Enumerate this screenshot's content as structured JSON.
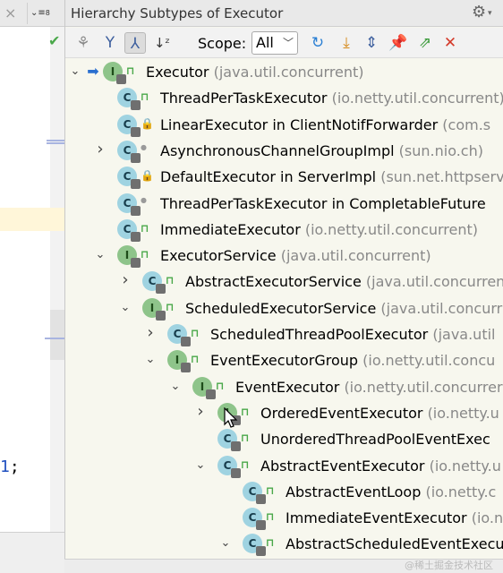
{
  "editor": {
    "tabs_menu": "⌄≡",
    "code_text": "1;",
    "code_number": "1"
  },
  "panel": {
    "title": "Hierarchy Subtypes of Executor",
    "toolbar": {
      "scope_label": "Scope:",
      "scope_value": "All"
    }
  },
  "tree": [
    {
      "label": "Executor",
      "pkg": "(java.util.concurrent)",
      "kind": "I",
      "vis": "pub",
      "arrow": "expanded",
      "level": 0
    },
    {
      "label": "ThreadPerTaskExecutor",
      "pkg": "(io.netty.util.concurrent)",
      "kind": "C",
      "vis": "pub",
      "arrow": "none",
      "level": 1
    },
    {
      "label": "LinearExecutor in ClientNotifForwarder",
      "pkg": "(com.s",
      "kind": "C",
      "vis": "priv",
      "arrow": "none",
      "level": 1
    },
    {
      "label": "AsynchronousChannelGroupImpl",
      "pkg": "(sun.nio.ch)",
      "kind": "C",
      "vis": "pkg",
      "arrow": "collapsed",
      "level": 1
    },
    {
      "label": "DefaultExecutor in ServerImpl",
      "pkg": "(sun.net.httpserv",
      "kind": "C",
      "vis": "priv",
      "arrow": "none",
      "level": 1
    },
    {
      "label": "ThreadPerTaskExecutor in CompletableFuture",
      "pkg": "",
      "kind": "C",
      "vis": "pkg",
      "arrow": "none",
      "level": 1
    },
    {
      "label": "ImmediateExecutor",
      "pkg": "(io.netty.util.concurrent)",
      "kind": "C",
      "vis": "pub",
      "arrow": "none",
      "level": 1
    },
    {
      "label": "ExecutorService",
      "pkg": "(java.util.concurrent)",
      "kind": "I",
      "vis": "pub",
      "arrow": "expanded",
      "level": 1
    },
    {
      "label": "AbstractExecutorService",
      "pkg": "(java.util.concurren",
      "kind": "C",
      "vis": "pub",
      "arrow": "collapsed",
      "level": 2
    },
    {
      "label": "ScheduledExecutorService",
      "pkg": "(java.util.concurr",
      "kind": "I",
      "vis": "pub",
      "arrow": "expanded",
      "level": 2
    },
    {
      "label": "ScheduledThreadPoolExecutor",
      "pkg": "(java.util",
      "kind": "C",
      "vis": "pub",
      "arrow": "collapsed",
      "level": 3
    },
    {
      "label": "EventExecutorGroup",
      "pkg": "(io.netty.util.concu",
      "kind": "I",
      "vis": "pub",
      "arrow": "expanded",
      "level": 3
    },
    {
      "label": "EventExecutor",
      "pkg": "(io.netty.util.concurrer",
      "kind": "I",
      "vis": "pub",
      "arrow": "expanded",
      "level": 4
    },
    {
      "label": "OrderedEventExecutor",
      "pkg": "(io.netty.u",
      "kind": "I",
      "vis": "pub",
      "arrow": "collapsed",
      "level": 5
    },
    {
      "label": "UnorderedThreadPoolEventExec",
      "pkg": "",
      "kind": "C",
      "vis": "pub",
      "arrow": "none",
      "level": 5
    },
    {
      "label": "AbstractEventExecutor",
      "pkg": "(io.netty.u",
      "kind": "C",
      "vis": "pub",
      "arrow": "expanded",
      "level": 5
    },
    {
      "label": "AbstractEventLoop",
      "pkg": "(io.netty.c",
      "kind": "C",
      "vis": "pub",
      "arrow": "none",
      "level": 6
    },
    {
      "label": "ImmediateEventExecutor",
      "pkg": "(io.n",
      "kind": "C",
      "vis": "pub",
      "arrow": "none",
      "level": 6
    },
    {
      "label": "AbstractScheduledEventExecu",
      "pkg": "",
      "kind": "C",
      "vis": "pub",
      "arrow": "expanded",
      "level": 6
    }
  ],
  "watermark": "@稀土掘金技术社区"
}
